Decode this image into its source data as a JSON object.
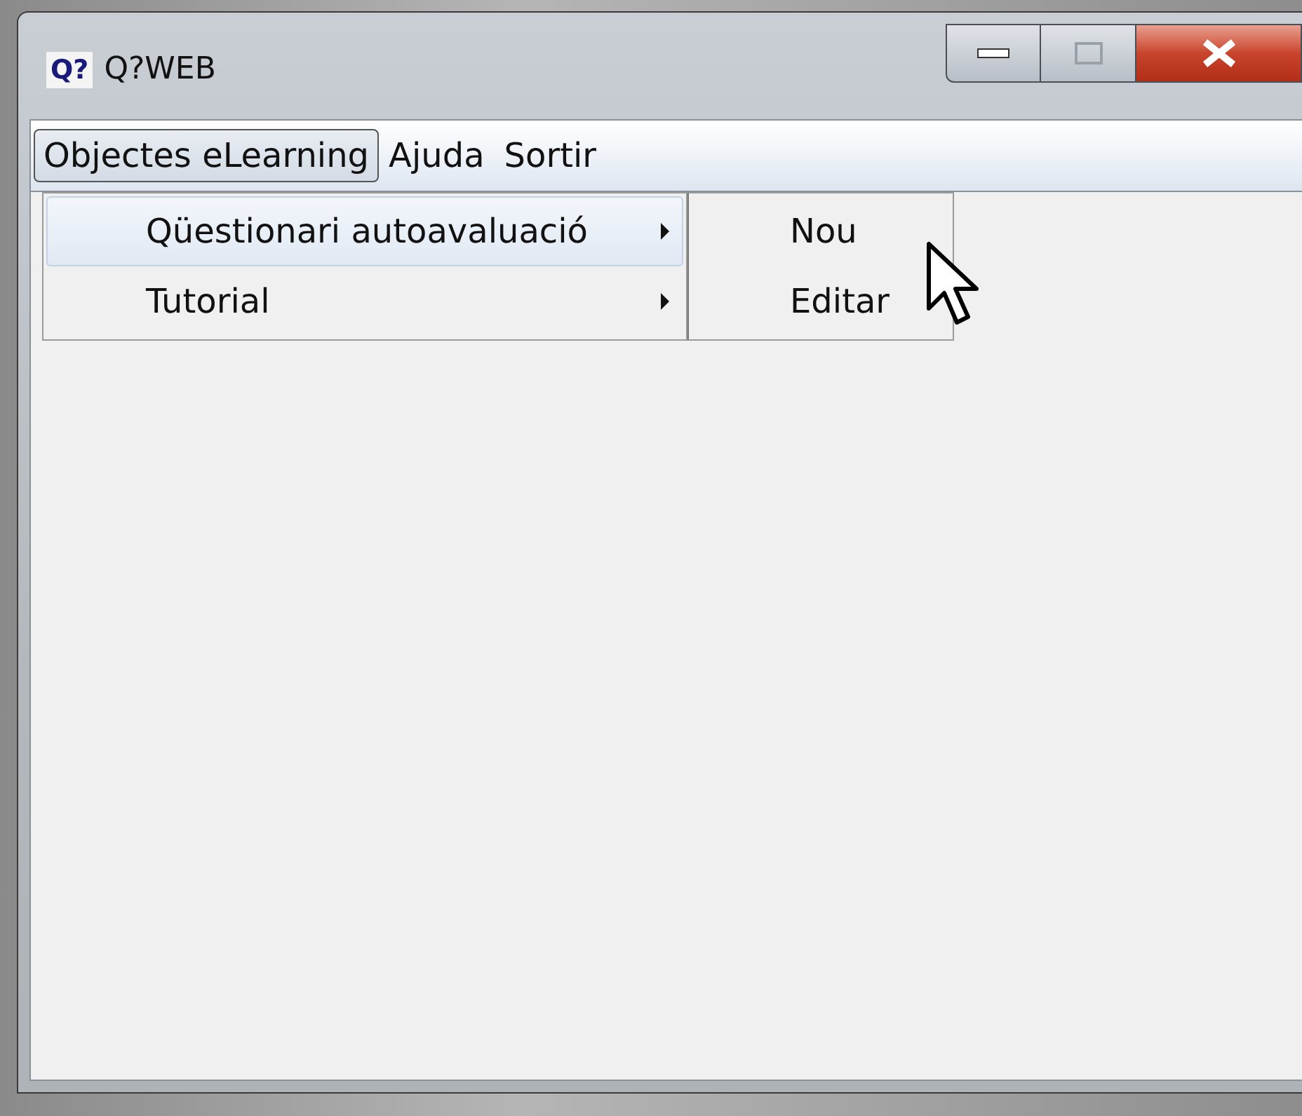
{
  "window": {
    "title": "Q?WEB",
    "app_icon": "Q?"
  },
  "menu_bar": [
    {
      "label": "Objectes eLearning",
      "selected": true
    },
    {
      "label": "Ajuda",
      "selected": false
    },
    {
      "label": "Sortir",
      "selected": false
    }
  ],
  "dropdown": [
    {
      "label": "Qüestionari autoavaluació",
      "selected": true,
      "has_submenu": true
    },
    {
      "label": "Tutorial",
      "selected": false,
      "has_submenu": true
    }
  ],
  "submenu": [
    {
      "label": "Nou"
    },
    {
      "label": "Editar"
    }
  ]
}
